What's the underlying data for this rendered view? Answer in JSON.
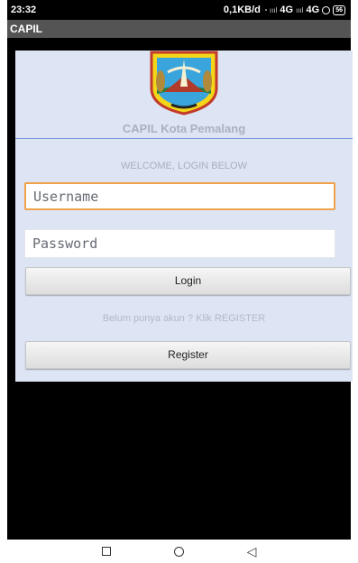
{
  "status_bar": {
    "time": "23:32",
    "network_speed": "0,1KB/d",
    "network_1": "4G",
    "network_2": "4G",
    "battery": "56"
  },
  "app_bar": {
    "title": "CAPIL"
  },
  "header": {
    "org_name": "CAPIL Kota Pemalang"
  },
  "form": {
    "welcome": "WELCOME, LOGIN BELOW",
    "username_placeholder": "Username",
    "password_placeholder": "Password",
    "login_label": "Login",
    "register_hint": "Belum punya akun ? Klik REGISTER",
    "register_label": "Register"
  },
  "colors": {
    "card_bg": "#dde4f3",
    "focus_border": "#f0a24a",
    "divider": "#7d97da",
    "appbar_bg": "#545454"
  },
  "icons": {
    "emblem": "regency-emblem",
    "nav_recent": "square-icon",
    "nav_home": "circle-icon",
    "nav_back": "triangle-back-icon"
  }
}
